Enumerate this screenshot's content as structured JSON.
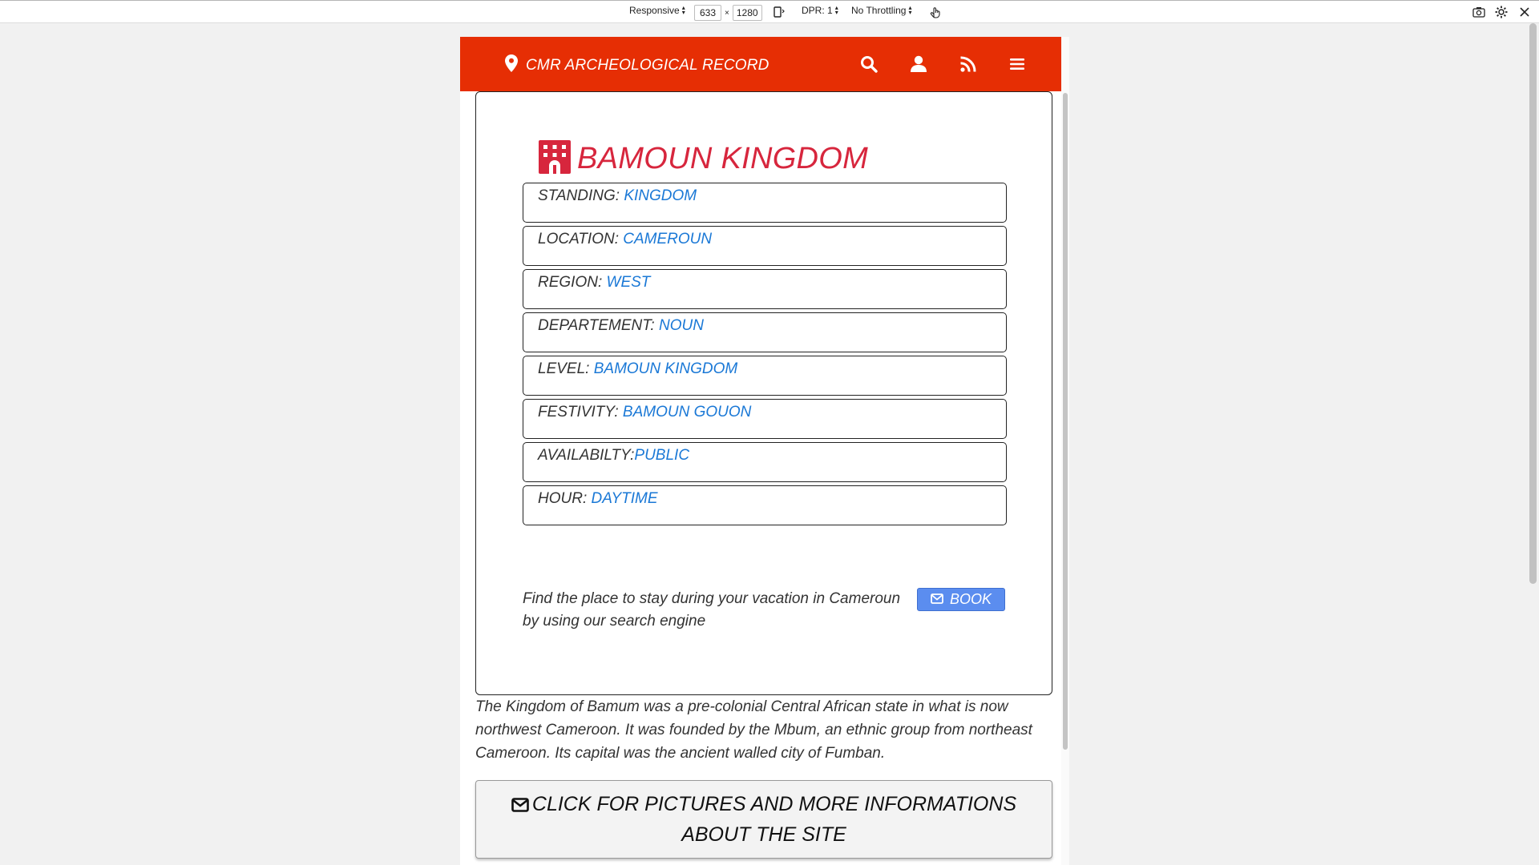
{
  "devtools": {
    "device": "Responsive",
    "width": "633",
    "times": "×",
    "height": "1280",
    "dpr": "DPR: 1",
    "throttling": "No Throttling"
  },
  "header": {
    "title": "CMR ARCHEOLOGICAL RECORD"
  },
  "page": {
    "heading": "BAMOUN KINGDOM",
    "rows": [
      {
        "label": "STANDING: ",
        "value": "KINGDOM"
      },
      {
        "label": "LOCATION: ",
        "value": "CAMEROUN"
      },
      {
        "label": "REGION: ",
        "value": "WEST"
      },
      {
        "label": "DEPARTEMENT: ",
        "value": "NOUN"
      },
      {
        "label": "LEVEL: ",
        "value": "BAMOUN KINGDOM"
      },
      {
        "label": "FESTIVITY: ",
        "value": "BAMOUN GOUON"
      },
      {
        "label": "AVAILABILTY:",
        "value": "PUBLIC"
      },
      {
        "label": "HOUR: ",
        "value": "DAYTIME"
      }
    ],
    "promo_text": "Find the place to stay during your vacation in Cameroun by using our search engine",
    "book_label": "BOOK",
    "description": "The Kingdom of Bamum was a pre-colonial Central African state in what is now northwest Cameroon. It was founded by the Mbum, an ethnic group from northeast Cameroon. Its capital was the ancient walled city of Fumban.",
    "more_button": "CLICK FOR PICTURES AND MORE INFORMATIONS ABOUT THE SITE"
  },
  "colors": {
    "header_bg": "#e62e04",
    "heading": "#d7263d",
    "value_link": "#1a78d6",
    "book_bg": "#5b8def"
  },
  "icons": {
    "brand": "map-marker-icon",
    "search": "search-icon",
    "user": "user-icon",
    "rss": "rss-icon",
    "menu": "hamburger-menu-icon",
    "heading": "building-icon",
    "book": "envelope-icon"
  }
}
